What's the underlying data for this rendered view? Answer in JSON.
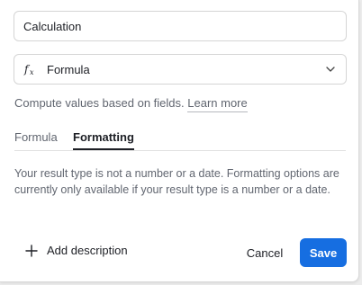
{
  "field": {
    "name_value": "Calculation",
    "type": {
      "icon": "formula-fx-icon",
      "label": "Formula"
    },
    "help_text": "Compute values based on fields.",
    "help_link": "Learn more"
  },
  "tabs": [
    {
      "label": "Formula",
      "active": false
    },
    {
      "label": "Formatting",
      "active": true
    }
  ],
  "formatting_message": "Your result type is not a number or a date. Formatting options are currently only available if your result type is a number or a date.",
  "footer": {
    "add_description": "Add description",
    "cancel": "Cancel",
    "save": "Save"
  },
  "colors": {
    "accent": "#166ee1",
    "text": "#1d1f25",
    "muted": "#616670"
  }
}
